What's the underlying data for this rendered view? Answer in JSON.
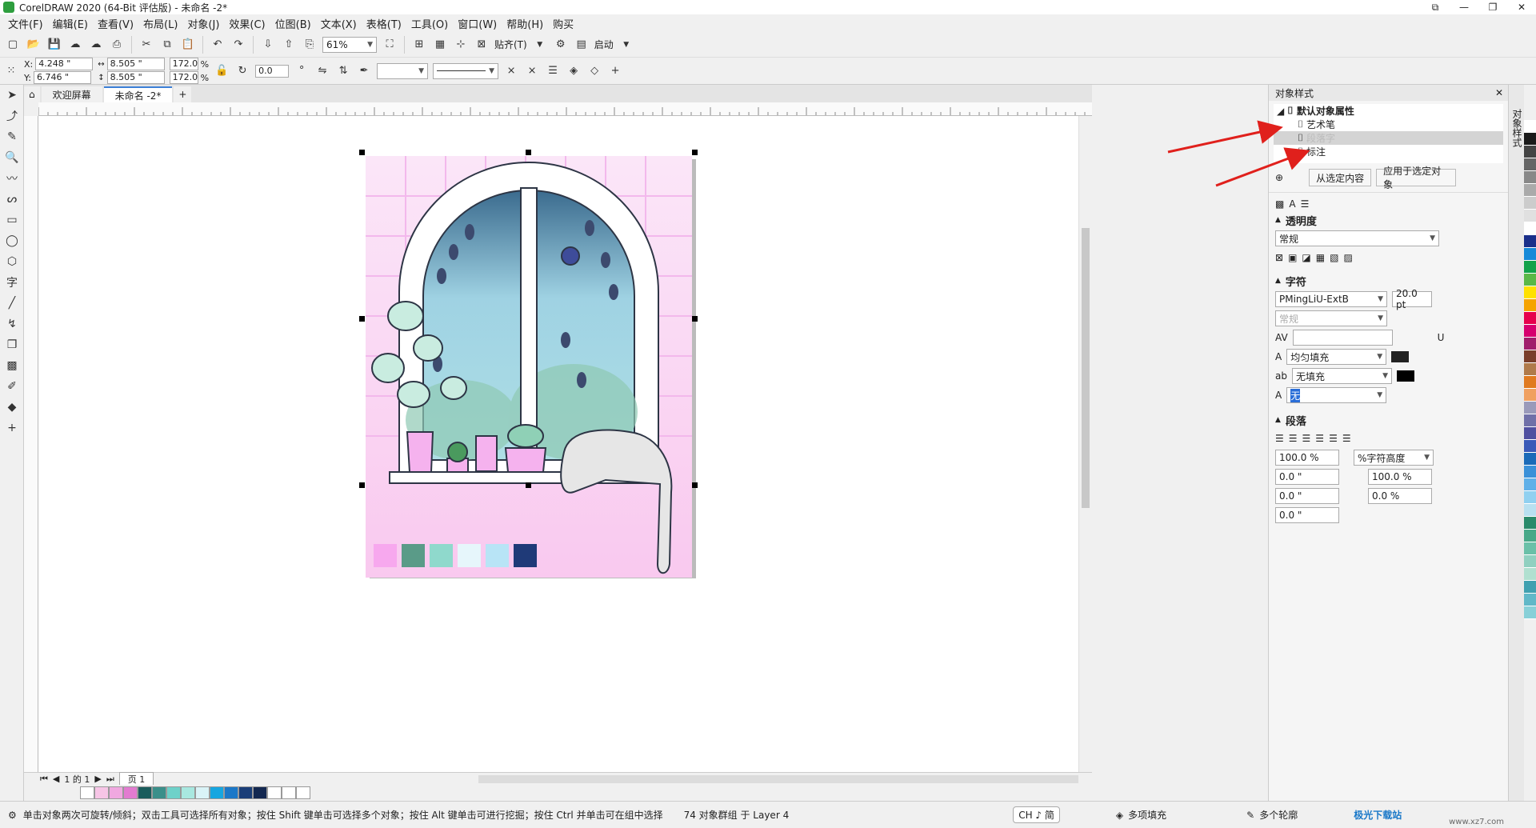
{
  "titlebar": {
    "title": "CorelDRAW 2020 (64-Bit 评估版) - 未命名 -2*"
  },
  "menu": [
    "文件(F)",
    "编辑(E)",
    "查看(V)",
    "布局(L)",
    "对象(J)",
    "效果(C)",
    "位图(B)",
    "文本(X)",
    "表格(T)",
    "工具(O)",
    "窗口(W)",
    "帮助(H)",
    "购买"
  ],
  "toolbar1": {
    "zoom": "61%",
    "snap": "贴齐(T)",
    "launch": "启动"
  },
  "toolbar2": {
    "x": "4.248 \"",
    "y": "6.746 \"",
    "w": "8.505 \"",
    "h": "8.505 \"",
    "sx": "172.0",
    "sy": "172.0",
    "pct": "%",
    "rotate": "0.0",
    "xl": "X:",
    "yl": "Y:"
  },
  "tabs": {
    "welcome": "欢迎屏幕",
    "doc": "未命名 -2*"
  },
  "canvas": {
    "swatch_colors": [
      "#f7a8ee",
      "#5a9b88",
      "#8fd9cc",
      "#e6f6fb",
      "#b8e4f6",
      "#1f3a78"
    ]
  },
  "bottomnav": {
    "page_info": "1 的 1",
    "page_tab": "页 1"
  },
  "palette_colors": [
    "#ffffff",
    "#f7c5e6",
    "#f0a8e0",
    "#e27bd0",
    "#1a5c5c",
    "#3a8f8a",
    "#6ed1c9",
    "#a8e8e0",
    "#d9f3f7",
    "#16a6e0",
    "#1b78c8",
    "#1a3e78",
    "#132850",
    "#ffffff",
    "#ffffff",
    "#ffffff"
  ],
  "status": {
    "hint": "单击对象两次可旋转/倾斜；双击工具可选择所有对象；按住 Shift 键单击可选择多个对象；按住 Alt 键单击可进行挖掘；按住 Ctrl 并单击可在组中选择",
    "info": "74 对象群组 于 Layer 4",
    "fill": "多项填充",
    "outline": "多个轮廓",
    "ime": "CH ♪ 简"
  },
  "panel": {
    "title": "对象样式",
    "tree": {
      "root": "默认对象属性",
      "items": [
        "艺术笔",
        "段落字",
        "标注"
      ]
    },
    "btn_from": "从选定内容",
    "btn_apply": "应用于选定对象",
    "transparency": {
      "label": "透明度",
      "mode": "常规"
    },
    "character": {
      "label": "字符",
      "font": "PMingLiU-ExtB",
      "size": "20.0 pt",
      "style": "常规",
      "fill": "均匀填充",
      "bg": "无填充",
      "outline": "无"
    },
    "paragraph": {
      "label": "段落",
      "line": "100.0 %",
      "line_unit": "%字符高度",
      "v1": "0.0 \"",
      "v2": "100.0 %",
      "v3": "0.0 \"",
      "v4": "0.0 %",
      "v5": "0.0 \""
    }
  },
  "sidetab": {
    "label": "对象样式"
  },
  "right_palette": [
    "#ffffff",
    "#1a1a1a",
    "#444444",
    "#666666",
    "#888888",
    "#aaaaaa",
    "#cccccc",
    "#e0e0e0",
    "#ffffff",
    "#1a2f8a",
    "#1689d8",
    "#12a24a",
    "#5ab847",
    "#ffe100",
    "#f5a300",
    "#e6004c",
    "#d6006e",
    "#a01e6b",
    "#7a3e2a",
    "#b07a4a",
    "#e07a20",
    "#f0a060",
    "#9a9aba",
    "#7070a8",
    "#5050a0",
    "#3a5ab8",
    "#1a6ab8",
    "#3a90d8",
    "#60b0e8",
    "#90d0f0",
    "#b8e0f0",
    "#2a8a6a",
    "#48a888",
    "#6ac0a8",
    "#90d0c0",
    "#b0e0d0",
    "#40a0b0",
    "#60b8c8",
    "#88d0d8"
  ],
  "watermark": "极光下载站",
  "watermark_url": "www.xz7.com"
}
